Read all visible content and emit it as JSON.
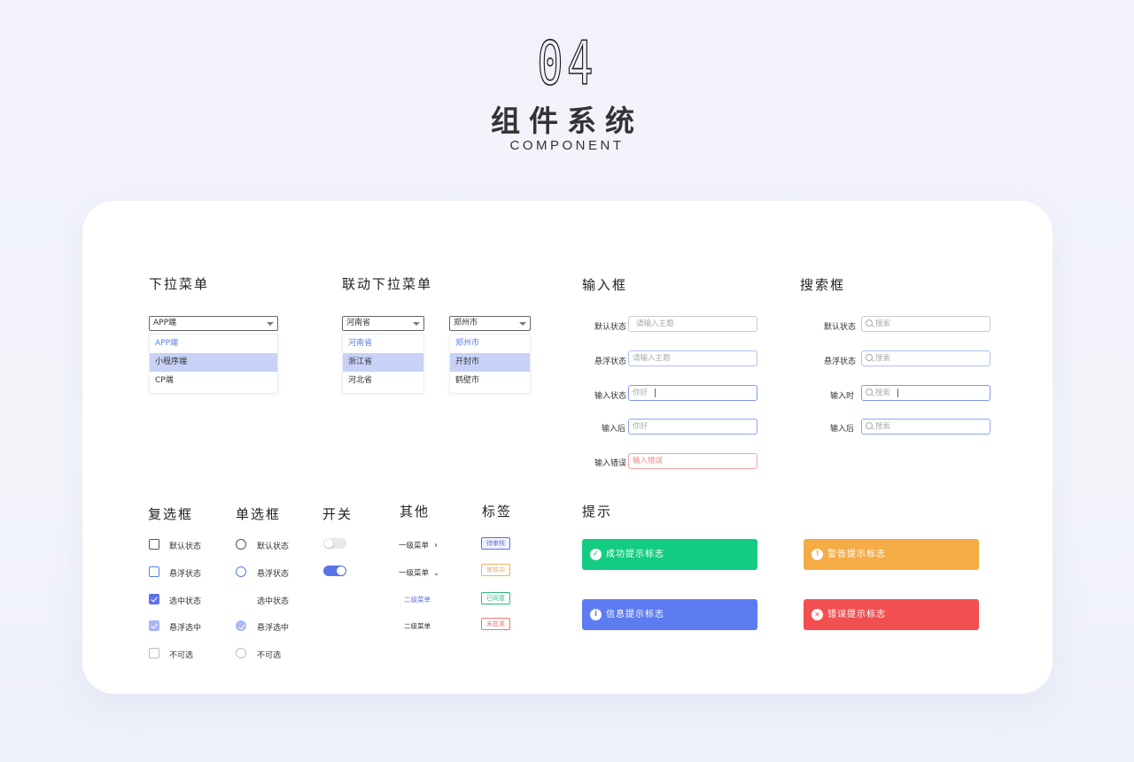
{
  "header": {
    "number": "04",
    "title_cn": "组件系统",
    "title_en": "COMPONENT"
  },
  "dropdown": {
    "title": "下拉菜单",
    "selected": "APP端",
    "options": [
      "APP端",
      "小程序端",
      "CP端"
    ]
  },
  "cascade": {
    "title": "联动下拉菜单",
    "province": {
      "selected": "河南省",
      "options": [
        "河南省",
        "浙江省",
        "河北省"
      ]
    },
    "city": {
      "selected": "郑州市",
      "options": [
        "郑州市",
        "开封市",
        "鹤壁市"
      ]
    }
  },
  "input": {
    "title": "输入框",
    "rows": [
      {
        "label": "默认状态",
        "text": "请输入主题"
      },
      {
        "label": "悬浮状态",
        "text": "请输入主题"
      },
      {
        "label": "输入状态",
        "text": "你好"
      },
      {
        "label": "输入后",
        "text": "你好"
      },
      {
        "label": "输入错误",
        "text": "输入错误"
      }
    ]
  },
  "search": {
    "title": "搜索框",
    "rows": [
      {
        "label": "默认状态",
        "text": "搜索"
      },
      {
        "label": "悬浮状态",
        "text": "搜索"
      },
      {
        "label": "输入时",
        "text": "搜索"
      },
      {
        "label": "输入后",
        "text": "搜索"
      }
    ]
  },
  "checkbox": {
    "title": "复选框",
    "labels": [
      "默认状态",
      "悬浮状态",
      "选中状态",
      "悬浮选中",
      "不可选"
    ]
  },
  "radio": {
    "title": "单选框",
    "labels": [
      "默认状态",
      "悬浮状态",
      "选中状态",
      "悬浮选中",
      "不可选"
    ]
  },
  "switch": {
    "title": "开关",
    "states": [
      "off",
      "on"
    ]
  },
  "other": {
    "title": "其他",
    "items": [
      "一级菜单",
      "一级菜单",
      "二级菜单",
      "二级菜单"
    ]
  },
  "tags": {
    "title": "标签",
    "items": [
      {
        "text": "待审核",
        "color": "#5b73e8"
      },
      {
        "text": "审核中",
        "color": "#f0b060"
      },
      {
        "text": "已同意",
        "color": "#2fb77a"
      },
      {
        "text": "未批准",
        "color": "#f07575"
      }
    ]
  },
  "alerts": {
    "title": "提示",
    "items": [
      {
        "text": "成功提示标志",
        "color": "#13cc82",
        "icon": "check-icon"
      },
      {
        "text": "警告提示标志",
        "color": "#f5ac46",
        "icon": "exclamation-icon"
      },
      {
        "text": "信息提示标志",
        "color": "#5d7cf2",
        "icon": "info-icon"
      },
      {
        "text": "错误提示标志",
        "color": "#f25050",
        "icon": "close-icon"
      }
    ]
  }
}
